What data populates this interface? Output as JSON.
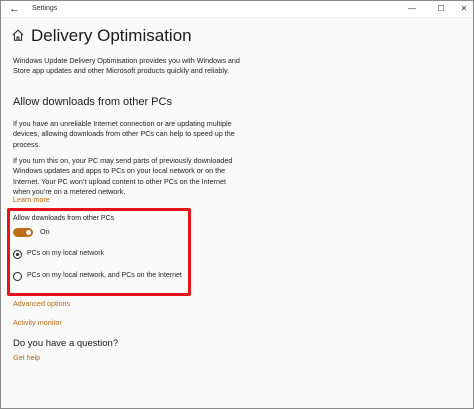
{
  "window": {
    "title": "Settings",
    "back_glyph": "←",
    "minimize_glyph": "—",
    "maximize_glyph": "☐",
    "close_glyph": "✕"
  },
  "page": {
    "title": "Delivery Optimisation",
    "intro": "Windows Update Delivery Optimisation provides you with Windows and Store app updates and other Microsoft products quickly and reliably."
  },
  "section": {
    "heading": "Allow downloads from other PCs",
    "para1": "If you have an unreliable Internet connection or are updating multiple devices, allowing downloads from other PCs can help to speed up the process.",
    "para2": "If you turn this on, your PC may send parts of previously downloaded Windows updates and apps to PCs on your local network or on the Internet. Your PC won’t upload content to other PCs on the Internet when you’re on a metered network.",
    "learn_more": "Learn more"
  },
  "setting": {
    "label": "Allow downloads from other PCs",
    "toggle_state": "On",
    "toggle_on": true,
    "options": [
      {
        "label": "PCs on my local network",
        "selected": true
      },
      {
        "label": "PCs on my local network, and PCs on the Internet",
        "selected": false
      }
    ]
  },
  "links": {
    "advanced_options": "Advanced options",
    "activity_monitor": "Activity monitor"
  },
  "help": {
    "heading": "Do you have a question?",
    "link": "Get help"
  },
  "colors": {
    "accent": "#c06e1a",
    "link": "#b96b12",
    "highlight_border": "#e8141c",
    "background": "#fafafa"
  }
}
